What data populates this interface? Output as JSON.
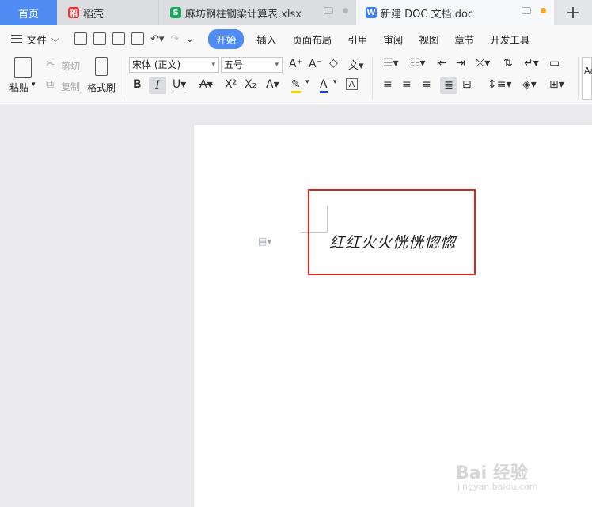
{
  "tabs": {
    "home": "首页",
    "daoke": "稻壳",
    "xlsx": "麻坊钢柱钢梁计算表.xlsx",
    "doc": "新建 DOC 文档.doc",
    "add": "+"
  },
  "menu": {
    "file": "文件",
    "tabs": [
      "开始",
      "插入",
      "页面布局",
      "引用",
      "审阅",
      "视图",
      "章节",
      "开发工具"
    ]
  },
  "ribbon": {
    "paste": "粘贴",
    "cut": "剪切",
    "copy": "复制",
    "format_painter": "格式刷",
    "font_name": "宋体 (正文)",
    "font_size": "五号"
  },
  "document": {
    "text": "红红火火恍恍惚惚"
  },
  "watermark": {
    "main": "Bai 经验",
    "sub": "jingyan.baidu.com"
  },
  "colors": {
    "accent": "#4e8cf4",
    "highlight_box": "#e2231a",
    "font_color_underline": "#1a3cd8",
    "highlighter_underline": "#f5d800"
  }
}
